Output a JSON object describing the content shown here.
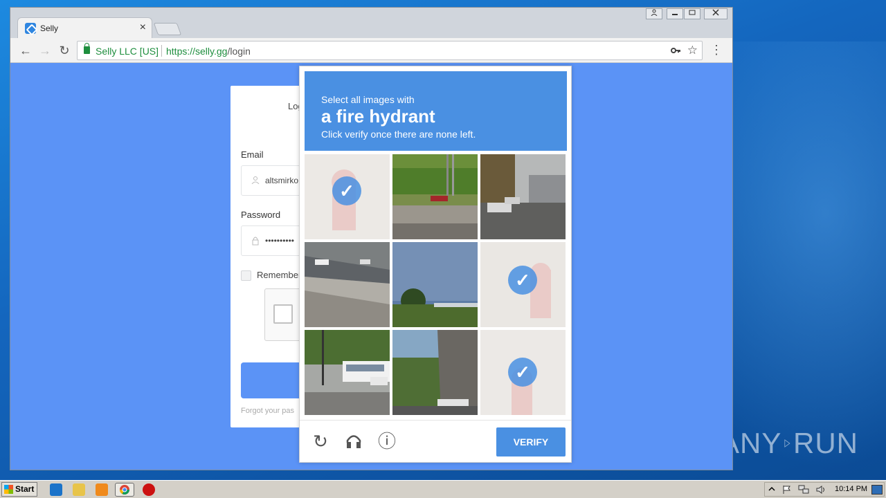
{
  "browser": {
    "tab_title": "Selly",
    "tab_close": "×",
    "back": "←",
    "forward": "→",
    "reload": "↻",
    "org": "Selly LLC [US]",
    "url_scheme_host": "https://selly.gg",
    "url_path": "/login",
    "key_icon": "key-icon",
    "bookmark_icon": "☆",
    "menu_icon": "⋮"
  },
  "login": {
    "heading": "Log",
    "email_label": "Email",
    "email_value": "altsmirko",
    "password_label": "Password",
    "password_value": "••••••••••",
    "remember_label": "Remember",
    "forgot_text": "Forgot your pas"
  },
  "challenge": {
    "line1": "Select all images with",
    "line2": "a fire hydrant",
    "line3": "Click verify once there are none left.",
    "verify_label": "VERIFY",
    "reload_icon": "↻",
    "audio_icon": "headphones-icon",
    "info_icon": "ⓘ",
    "tiles": [
      {
        "selected": true
      },
      {
        "selected": false
      },
      {
        "selected": false
      },
      {
        "selected": false
      },
      {
        "selected": false
      },
      {
        "selected": true
      },
      {
        "selected": false
      },
      {
        "selected": false
      },
      {
        "selected": true
      }
    ]
  },
  "taskbar": {
    "start_label": "Start",
    "clock": "10:14 PM"
  },
  "watermark": {
    "left": "ANY",
    "right": "RUN"
  }
}
